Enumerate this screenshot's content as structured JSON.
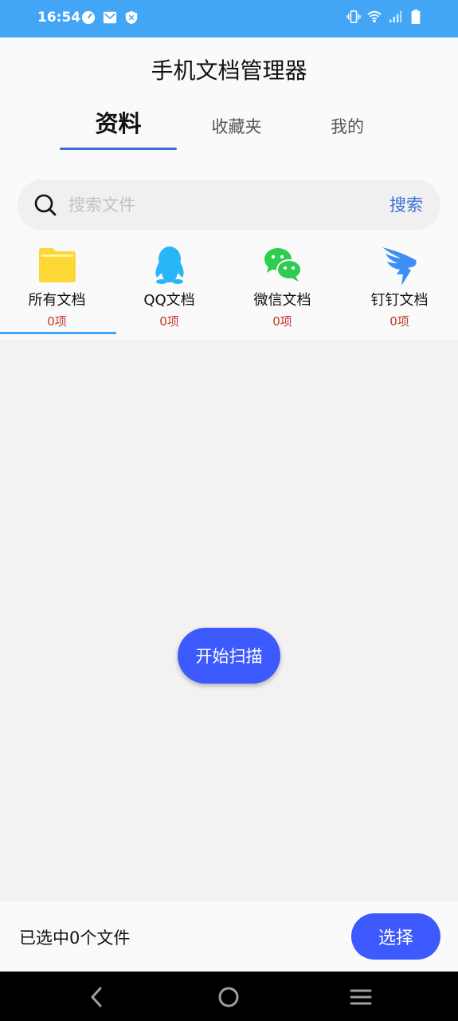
{
  "status_bar": {
    "time": "16:54",
    "left_icons": [
      "speedometer-icon",
      "mail-icon",
      "shield-icon"
    ],
    "right_icons": [
      "vibrate-icon",
      "wifi-icon",
      "signal-icon",
      "battery-icon"
    ]
  },
  "app": {
    "title": "手机文档管理器",
    "accent_color": "#3d5afe",
    "status_color": "#42a5f5"
  },
  "tabs": [
    {
      "label": "资料",
      "active": true
    },
    {
      "label": "收藏夹",
      "active": false
    },
    {
      "label": "我的",
      "active": false
    }
  ],
  "search": {
    "placeholder": "搜索文件",
    "value": "",
    "button_label": "搜索"
  },
  "categories": [
    {
      "label": "所有文档",
      "count": "0项",
      "icon": "folder-icon",
      "selected": true
    },
    {
      "label": "QQ文档",
      "count": "0项",
      "icon": "qq-icon",
      "selected": false
    },
    {
      "label": "微信文档",
      "count": "0项",
      "icon": "wechat-icon",
      "selected": false
    },
    {
      "label": "钉钉文档",
      "count": "0项",
      "icon": "dingtalk-icon",
      "selected": false
    }
  ],
  "main": {
    "scan_button_label": "开始扫描"
  },
  "bottom_bar": {
    "selected_text": "已选中0个文件",
    "select_button_label": "选择"
  },
  "nav_bar": {
    "buttons": [
      "back-icon",
      "home-icon",
      "menu-icon"
    ]
  }
}
